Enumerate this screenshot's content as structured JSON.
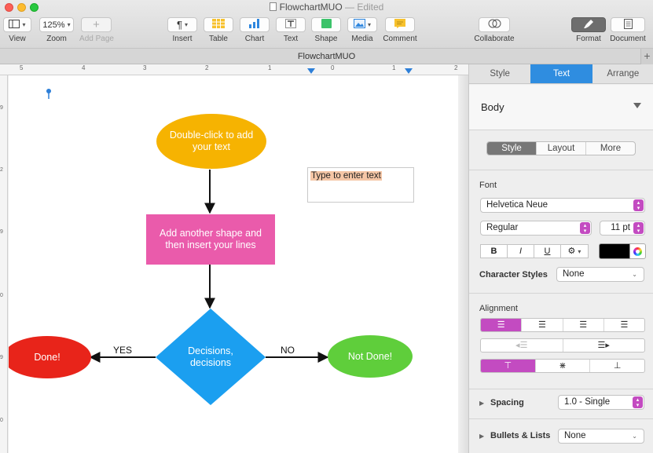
{
  "window": {
    "title": "FlowchartMUO",
    "status": "— Edited"
  },
  "toolbar": {
    "view_label": "View",
    "zoom_value": "125%",
    "zoom_label": "Zoom",
    "add_page_label": "Add Page",
    "insert_label": "Insert",
    "table_label": "Table",
    "chart_label": "Chart",
    "text_label": "Text",
    "shape_label": "Shape",
    "media_label": "Media",
    "comment_label": "Comment",
    "collaborate_label": "Collaborate",
    "format_label": "Format",
    "document_label": "Document"
  },
  "doc_strip": {
    "title": "FlowchartMUO"
  },
  "ruler": {
    "h_numbers": [
      "5",
      "4",
      "3",
      "2",
      "1",
      "0",
      "1",
      "2"
    ],
    "v_numbers": [
      "9",
      "2",
      "9",
      "0",
      "9",
      "0"
    ]
  },
  "canvas": {
    "start_shape": "Double-click to add your text",
    "process_shape": "Add another shape and then insert your lines",
    "decision_shape": "Decisions, decisions",
    "done_shape": "Done!",
    "not_done_shape": "Not Done!",
    "yes_label": "YES",
    "no_label": "NO",
    "textbox_text": "Type to enter text"
  },
  "inspector": {
    "tabs": [
      "Style",
      "Text",
      "Arrange"
    ],
    "paragraph_style": "Body",
    "sub_tabs": [
      "Style",
      "Layout",
      "More"
    ],
    "font_section": "Font",
    "font_family": "Helvetica Neue",
    "font_weight": "Regular",
    "font_size": "11 pt",
    "bold": "B",
    "italic": "I",
    "underline": "U",
    "character_styles_label": "Character Styles",
    "character_styles_value": "None",
    "alignment_section": "Alignment",
    "spacing_label": "Spacing",
    "spacing_value": "1.0 - Single",
    "bullets_label": "Bullets & Lists",
    "bullets_value": "None"
  },
  "colors": {
    "accent_blue": "#2f8de0",
    "start_fill": "#f6b301",
    "process_fill": "#ea5bab",
    "decision_fill": "#1b9ff0",
    "done_fill": "#e8241a",
    "not_done_fill": "#5fce3b",
    "segment_purple": "#c34bc1"
  }
}
